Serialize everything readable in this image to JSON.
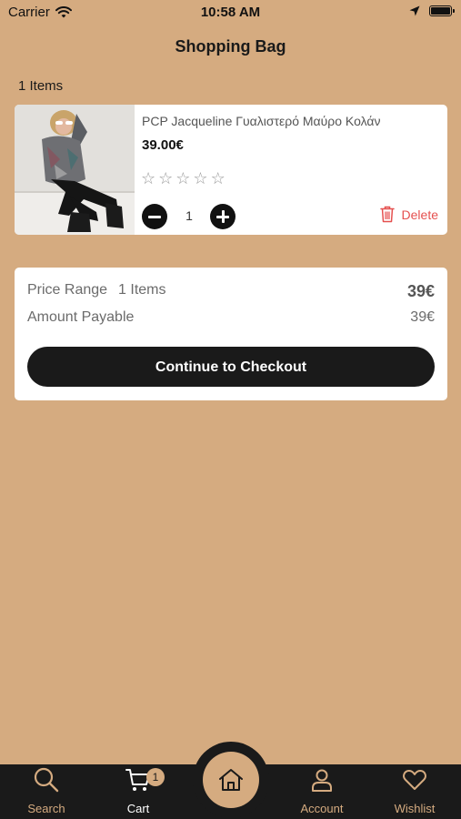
{
  "status_bar": {
    "carrier": "Carrier",
    "time": "10:58 AM",
    "icons": [
      "wifi-icon",
      "location-icon",
      "battery-icon"
    ]
  },
  "header": {
    "title": "Shopping Bag"
  },
  "bag": {
    "items_count": "1 Items",
    "items": [
      {
        "name": "PCP Jacqueline Γυαλιστερό Μαύρο Κολάν",
        "price": "39.00€",
        "rating": 0,
        "rating_max": 5,
        "quantity": "1",
        "delete_label": "Delete"
      }
    ]
  },
  "summary": {
    "price_range_label": "Price Range",
    "price_range_items": "1 Items",
    "price_range_value": "39€",
    "amount_payable_label": "Amount Payable",
    "amount_payable_value": "39€",
    "checkout_label": "Continue to Checkout"
  },
  "tabbar": {
    "search_label": "Search",
    "cart_label": "Cart",
    "cart_badge": "1",
    "account_label": "Account",
    "wishlist_label": "Wishlist",
    "active": "Cart"
  },
  "colors": {
    "background": "#D5AB80",
    "dark": "#1A1A1A",
    "delete": "#E5504F",
    "accent": "#D5AB80"
  }
}
